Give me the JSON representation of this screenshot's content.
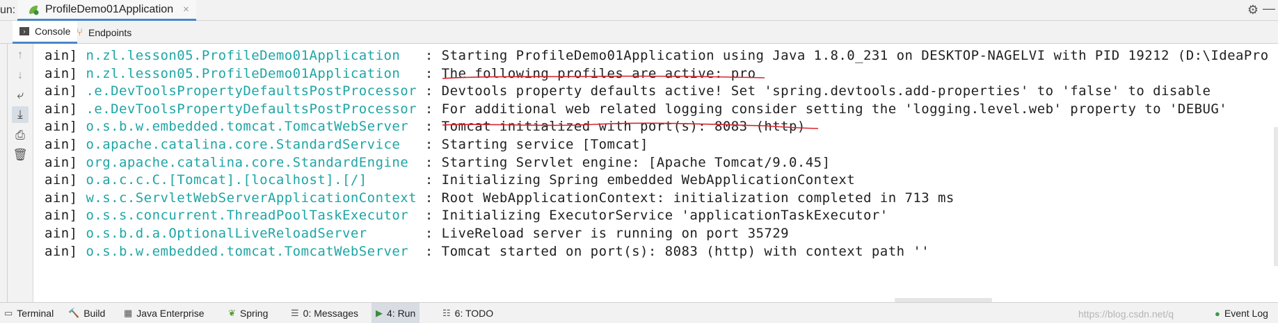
{
  "run_bar": {
    "label": "un:",
    "app_tab": "ProfileDemo01Application",
    "close_glyph": "×"
  },
  "sub_tabs": [
    {
      "label": "Console",
      "icon": "console-icon"
    },
    {
      "label": "Endpoints",
      "icon": "endpoints-icon"
    }
  ],
  "left_tools": [
    "up-arrow-icon",
    "down-arrow-icon",
    "soft-wrap-icon",
    "scroll-to-end-icon",
    "print-icon",
    "trash-icon"
  ],
  "log_lines": [
    {
      "thread": "ain]",
      "source": "n.zl.lesson05.ProfileDemo01Application   ",
      "message": ": Starting ProfileDemo01Application using Java 1.8.0_231 on DESKTOP-NAGELVI with PID 19212 (D:\\IdeaPro"
    },
    {
      "thread": "ain]",
      "source": "n.zl.lesson05.ProfileDemo01Application   ",
      "message": ": The following profiles are active: pro"
    },
    {
      "thread": "ain]",
      "source": ".e.DevToolsPropertyDefaultsPostProcessor ",
      "message": ": Devtools property defaults active! Set 'spring.devtools.add-properties' to 'false' to disable"
    },
    {
      "thread": "ain]",
      "source": ".e.DevToolsPropertyDefaultsPostProcessor ",
      "message": ": For additional web related logging consider setting the 'logging.level.web' property to 'DEBUG'"
    },
    {
      "thread": "ain]",
      "source": "o.s.b.w.embedded.tomcat.TomcatWebServer  ",
      "message": ": Tomcat initialized with port(s): 8083 (http)"
    },
    {
      "thread": "ain]",
      "source": "o.apache.catalina.core.StandardService   ",
      "message": ": Starting service [Tomcat]"
    },
    {
      "thread": "ain]",
      "source": "org.apache.catalina.core.StandardEngine  ",
      "message": ": Starting Servlet engine: [Apache Tomcat/9.0.45]"
    },
    {
      "thread": "ain]",
      "source": "o.a.c.c.C.[Tomcat].[localhost].[/]       ",
      "message": ": Initializing Spring embedded WebApplicationContext"
    },
    {
      "thread": "ain]",
      "source": "w.s.c.ServletWebServerApplicationContext ",
      "message": ": Root WebApplicationContext: initialization completed in 713 ms"
    },
    {
      "thread": "ain]",
      "source": "o.s.s.concurrent.ThreadPoolTaskExecutor  ",
      "message": ": Initializing ExecutorService 'applicationTaskExecutor'"
    },
    {
      "thread": "ain]",
      "source": "o.s.b.d.a.OptionalLiveReloadServer       ",
      "message": ": LiveReload server is running on port 35729"
    },
    {
      "thread": "ain]",
      "source": "o.s.b.w.embedded.tomcat.TomcatWebServer  ",
      "message": ": Tomcat started on port(s): 8083 (http) with context path ''"
    }
  ],
  "bottom_tabs": [
    {
      "label": "Terminal",
      "icon": "terminal-icon",
      "active": false
    },
    {
      "label": "Build",
      "icon": "hammer-icon",
      "active": false
    },
    {
      "label": "Java Enterprise",
      "icon": "java-enterprise-icon",
      "active": false
    },
    {
      "label": "Spring",
      "icon": "spring-leaf-icon",
      "active": false
    },
    {
      "label": "0: Messages",
      "icon": "messages-icon",
      "active": false
    },
    {
      "label": "4: Run",
      "icon": "run-icon",
      "active": true
    },
    {
      "label": "6: TODO",
      "icon": "todo-list-icon",
      "active": false
    }
  ],
  "event_log": {
    "label": "Event Log",
    "icon": "event-log-icon"
  },
  "watermark": "https://blog.csdn.net/q",
  "colors": {
    "logger_teal": "#1fa5a5",
    "annotation_red": "#d9232d",
    "active_tab_underline": "#4a86c8"
  }
}
